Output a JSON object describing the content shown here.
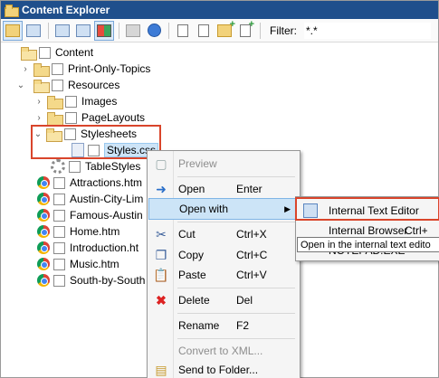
{
  "window": {
    "title": "Content Explorer"
  },
  "toolbar": {
    "filter_label": "Filter:",
    "filter_value": "*.*"
  },
  "tree": {
    "root": "Content",
    "items": [
      {
        "label": "Print-Only-Topics"
      },
      {
        "label": "Resources"
      },
      {
        "label": "Images"
      },
      {
        "label": "PageLayouts"
      },
      {
        "label": "Stylesheets"
      },
      {
        "label": "Styles.css"
      },
      {
        "label": "TableStyles"
      },
      {
        "label": "Attractions.htm"
      },
      {
        "label": "Austin-City-Lim"
      },
      {
        "label": "Famous-Austin"
      },
      {
        "label": "Home.htm"
      },
      {
        "label": "Introduction.ht"
      },
      {
        "label": "Music.htm"
      },
      {
        "label": "South-by-South"
      }
    ]
  },
  "context_menu": {
    "preview": "Preview",
    "open": "Open",
    "open_key": "Enter",
    "open_with": "Open with",
    "cut": "Cut",
    "cut_key": "Ctrl+X",
    "copy": "Copy",
    "copy_key": "Ctrl+C",
    "paste": "Paste",
    "paste_key": "Ctrl+V",
    "delete": "Delete",
    "delete_key": "Del",
    "rename": "Rename",
    "rename_key": "F2",
    "convert": "Convert to XML...",
    "send": "Send to Folder..."
  },
  "submenu": {
    "internal_text_editor": "Internal Text Editor",
    "internal_browser": "Internal Browser",
    "internal_browser_key": "Ctrl+",
    "notepad": "NOTEPAD.EXE"
  },
  "tooltip": {
    "text": "Open in the internal text edito"
  },
  "colors": {
    "title_bar": "#1f4f8c",
    "highlight_border": "#d9452b",
    "selection": "#cde4f7"
  }
}
